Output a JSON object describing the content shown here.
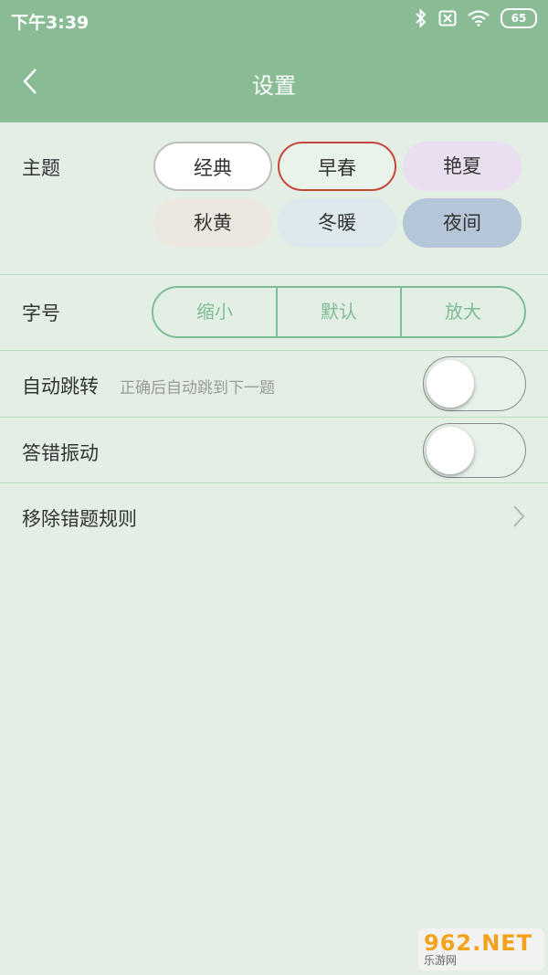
{
  "status_bar": {
    "time": "下午3:39",
    "battery": "65"
  },
  "header": {
    "title": "设置"
  },
  "theme": {
    "label": "主题",
    "options": [
      "经典",
      "早春",
      "艳夏",
      "秋黄",
      "冬暖",
      "夜间"
    ],
    "selected": "早春"
  },
  "font_size": {
    "label": "字号",
    "options": [
      "缩小",
      "默认",
      "放大"
    ],
    "selected": "默认"
  },
  "auto_jump": {
    "label": "自动跳转",
    "description": "正确后自动跳到下一题",
    "enabled": false
  },
  "vibrate": {
    "label": "答错振动",
    "enabled": false
  },
  "remove_rule": {
    "label": "移除错题规则"
  },
  "watermark": {
    "brand": "962.NET",
    "sub": "乐游网"
  },
  "colors": {
    "header": "#89bb95",
    "background": "#e3efe5",
    "accent": "#7fbd95",
    "selected_border": "#c9473a"
  }
}
